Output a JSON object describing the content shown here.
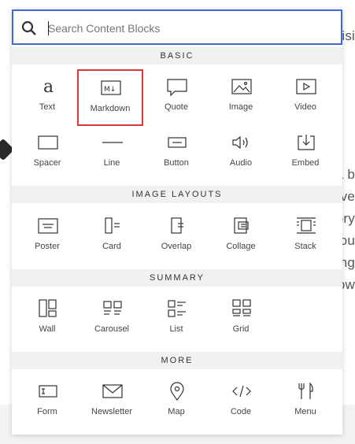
{
  "search": {
    "placeholder": "Search Content Blocks",
    "value": ""
  },
  "background": {
    "fragments": [
      "isi",
      "a b",
      "ve",
      "ory",
      "Sou",
      "ng",
      "ow"
    ]
  },
  "sections": [
    {
      "title": "BASIC",
      "items": [
        {
          "label": "Text",
          "icon": "text-icon"
        },
        {
          "label": "Markdown",
          "icon": "markdown-icon",
          "selected": true
        },
        {
          "label": "Quote",
          "icon": "quote-icon"
        },
        {
          "label": "Image",
          "icon": "image-icon"
        },
        {
          "label": "Video",
          "icon": "video-icon"
        },
        {
          "label": "Spacer",
          "icon": "spacer-icon"
        },
        {
          "label": "Line",
          "icon": "line-icon"
        },
        {
          "label": "Button",
          "icon": "button-icon"
        },
        {
          "label": "Audio",
          "icon": "audio-icon"
        },
        {
          "label": "Embed",
          "icon": "embed-icon"
        }
      ]
    },
    {
      "title": "IMAGE LAYOUTS",
      "items": [
        {
          "label": "Poster",
          "icon": "poster-icon"
        },
        {
          "label": "Card",
          "icon": "card-icon"
        },
        {
          "label": "Overlap",
          "icon": "overlap-icon"
        },
        {
          "label": "Collage",
          "icon": "collage-icon"
        },
        {
          "label": "Stack",
          "icon": "stack-icon"
        }
      ]
    },
    {
      "title": "SUMMARY",
      "items": [
        {
          "label": "Wall",
          "icon": "wall-icon"
        },
        {
          "label": "Carousel",
          "icon": "carousel-icon"
        },
        {
          "label": "List",
          "icon": "list-icon"
        },
        {
          "label": "Grid",
          "icon": "grid-icon"
        }
      ]
    },
    {
      "title": "MORE",
      "items": [
        {
          "label": "Form",
          "icon": "form-icon"
        },
        {
          "label": "Newsletter",
          "icon": "newsletter-icon"
        },
        {
          "label": "Map",
          "icon": "map-icon"
        },
        {
          "label": "Code",
          "icon": "code-icon"
        },
        {
          "label": "Menu",
          "icon": "menu-icon"
        }
      ]
    }
  ]
}
